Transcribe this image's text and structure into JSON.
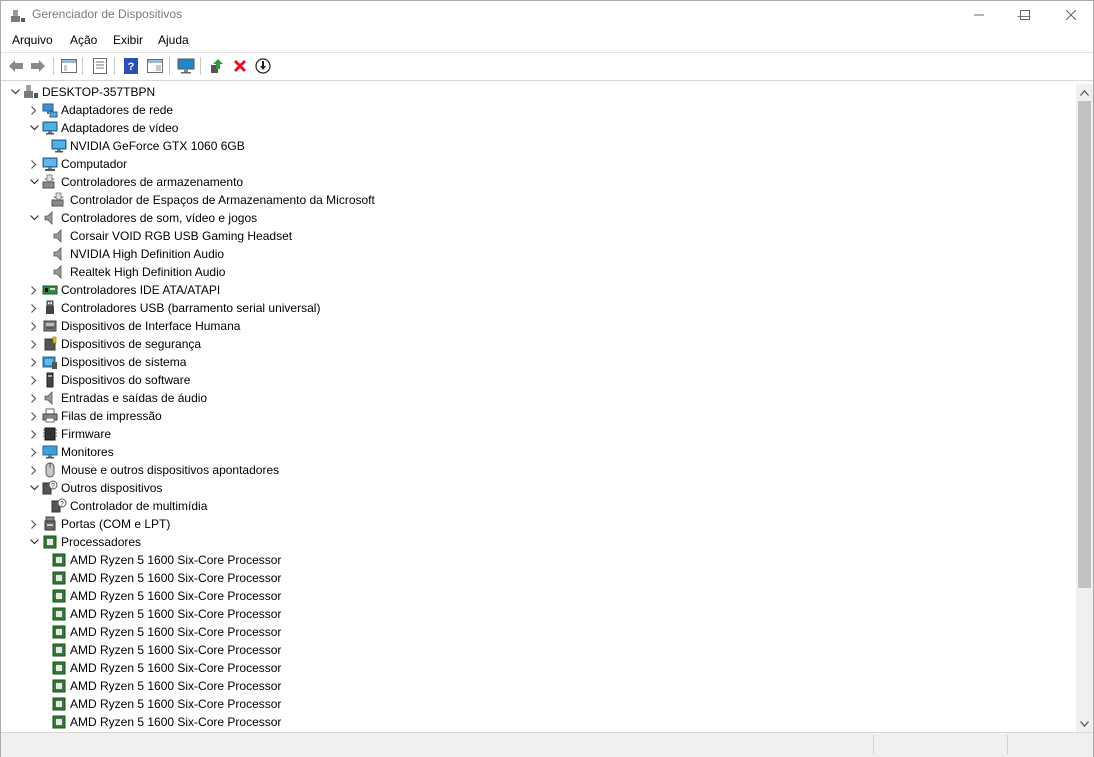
{
  "window": {
    "title": "Gerenciador de Dispositivos",
    "controls": {
      "minimize": "—",
      "maximize": "☐",
      "close": "✕"
    }
  },
  "menu": [
    "Arquivo",
    "Ação",
    "Exibir",
    "Ajuda"
  ],
  "toolbar": {
    "buttons": [
      "back-icon",
      "forward-icon",
      "show-hide-tree-icon",
      "properties-icon",
      "help-icon",
      "action-view-icon",
      "monitor-scan-icon",
      "update-driver-icon",
      "uninstall-icon",
      "disable-device-icon"
    ]
  },
  "tree": {
    "root": "DESKTOP-357TBPN",
    "rows": [
      {
        "level": 1,
        "expand": "closed",
        "icon": "network",
        "label": "Adaptadores de rede"
      },
      {
        "level": 1,
        "expand": "open",
        "icon": "display",
        "label": "Adaptadores de vídeo"
      },
      {
        "level": 2,
        "expand": "none",
        "icon": "display",
        "label": "NVIDIA GeForce GTX 1060 6GB"
      },
      {
        "level": 1,
        "expand": "closed",
        "icon": "computer",
        "label": "Computador"
      },
      {
        "level": 1,
        "expand": "open",
        "icon": "storage",
        "label": "Controladores de armazenamento"
      },
      {
        "level": 2,
        "expand": "none",
        "icon": "storage",
        "label": "Controlador de Espaços de Armazenamento da Microsoft"
      },
      {
        "level": 1,
        "expand": "open",
        "icon": "speaker",
        "label": "Controladores de som, vídeo e jogos"
      },
      {
        "level": 2,
        "expand": "none",
        "icon": "speaker",
        "label": "Corsair VOID RGB USB Gaming Headset"
      },
      {
        "level": 2,
        "expand": "none",
        "icon": "speaker",
        "label": "NVIDIA High Definition Audio"
      },
      {
        "level": 2,
        "expand": "none",
        "icon": "speaker",
        "label": "Realtek High Definition Audio"
      },
      {
        "level": 1,
        "expand": "closed",
        "icon": "ide",
        "label": "Controladores IDE ATA/ATAPI"
      },
      {
        "level": 1,
        "expand": "closed",
        "icon": "usb",
        "label": "Controladores USB (barramento serial universal)"
      },
      {
        "level": 1,
        "expand": "closed",
        "icon": "hid",
        "label": "Dispositivos de Interface Humana"
      },
      {
        "level": 1,
        "expand": "closed",
        "icon": "security",
        "label": "Dispositivos de segurança"
      },
      {
        "level": 1,
        "expand": "closed",
        "icon": "system",
        "label": "Dispositivos de sistema"
      },
      {
        "level": 1,
        "expand": "closed",
        "icon": "software",
        "label": "Dispositivos do software"
      },
      {
        "level": 1,
        "expand": "closed",
        "icon": "speaker",
        "label": "Entradas e saídas de áudio"
      },
      {
        "level": 1,
        "expand": "closed",
        "icon": "printer",
        "label": "Filas de impressão"
      },
      {
        "level": 1,
        "expand": "closed",
        "icon": "firmware",
        "label": "Firmware"
      },
      {
        "level": 1,
        "expand": "closed",
        "icon": "monitor",
        "label": "Monitores"
      },
      {
        "level": 1,
        "expand": "closed",
        "icon": "mouse",
        "label": "Mouse e outros dispositivos apontadores"
      },
      {
        "level": 1,
        "expand": "open",
        "icon": "unknown",
        "label": "Outros dispositivos"
      },
      {
        "level": 2,
        "expand": "none",
        "icon": "unknown",
        "label": "Controlador de multimídia"
      },
      {
        "level": 1,
        "expand": "closed",
        "icon": "port",
        "label": "Portas (COM e LPT)"
      },
      {
        "level": 1,
        "expand": "open",
        "icon": "cpu",
        "label": "Processadores"
      },
      {
        "level": 2,
        "expand": "none",
        "icon": "cpu",
        "label": "AMD Ryzen 5 1600 Six-Core Processor"
      },
      {
        "level": 2,
        "expand": "none",
        "icon": "cpu",
        "label": "AMD Ryzen 5 1600 Six-Core Processor"
      },
      {
        "level": 2,
        "expand": "none",
        "icon": "cpu",
        "label": "AMD Ryzen 5 1600 Six-Core Processor"
      },
      {
        "level": 2,
        "expand": "none",
        "icon": "cpu",
        "label": "AMD Ryzen 5 1600 Six-Core Processor"
      },
      {
        "level": 2,
        "expand": "none",
        "icon": "cpu",
        "label": "AMD Ryzen 5 1600 Six-Core Processor"
      },
      {
        "level": 2,
        "expand": "none",
        "icon": "cpu",
        "label": "AMD Ryzen 5 1600 Six-Core Processor"
      },
      {
        "level": 2,
        "expand": "none",
        "icon": "cpu",
        "label": "AMD Ryzen 5 1600 Six-Core Processor"
      },
      {
        "level": 2,
        "expand": "none",
        "icon": "cpu",
        "label": "AMD Ryzen 5 1600 Six-Core Processor"
      },
      {
        "level": 2,
        "expand": "none",
        "icon": "cpu",
        "label": "AMD Ryzen 5 1600 Six-Core Processor"
      },
      {
        "level": 2,
        "expand": "none",
        "icon": "cpu",
        "label": "AMD Ryzen 5 1600 Six-Core Processor"
      }
    ]
  },
  "colors": {
    "title_text": "#7a7a7a",
    "cpu_green": "#2e7d32",
    "display_blue": "#1e88c8",
    "delete_red": "#e81123"
  }
}
